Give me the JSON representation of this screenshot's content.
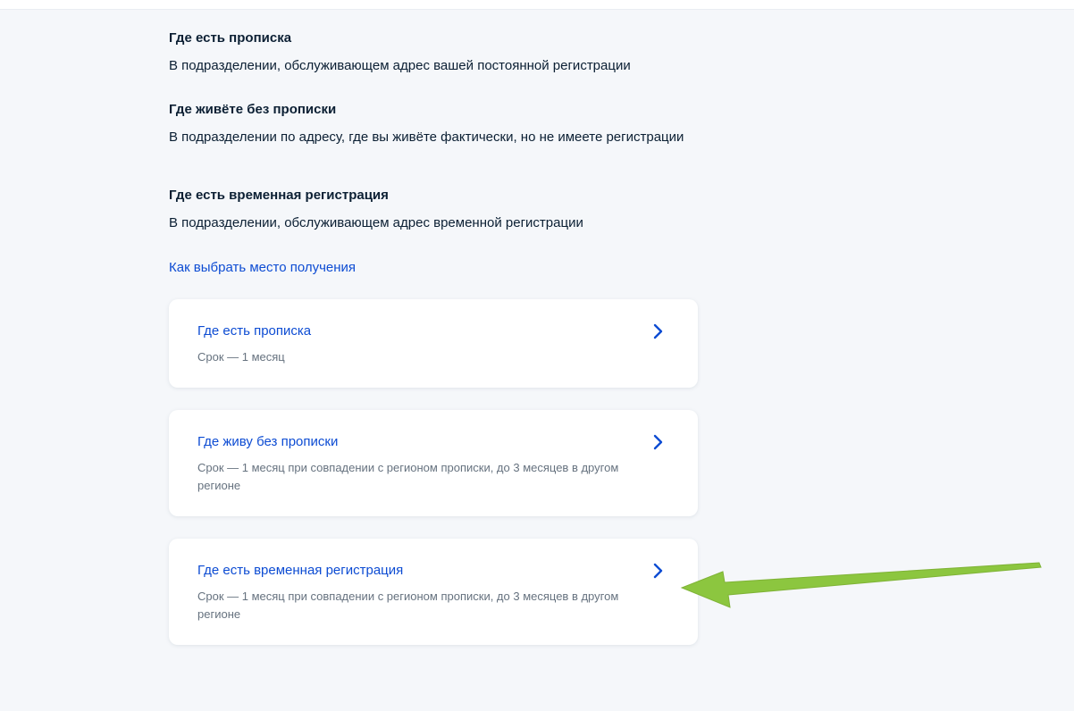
{
  "sections": [
    {
      "title": "Где есть прописка",
      "text": "В подразделении, обслуживающем адрес вашей постоянной регистрации"
    },
    {
      "title": "Где живёте без прописки",
      "text": "В подразделении по адресу, где вы живёте фактически, но не имеете регистрации"
    },
    {
      "title": "Где есть временная регистрация",
      "text": "В подразделении, обслуживающем адрес временной регистрации"
    }
  ],
  "link": {
    "label": "Как выбрать место получения"
  },
  "options": [
    {
      "title": "Где есть прописка",
      "subtitle": "Срок — 1 месяц"
    },
    {
      "title": "Где живу без прописки",
      "subtitle": "Срок — 1 месяц при совпадении с регионом прописки, до 3 месяцев в другом регионе"
    },
    {
      "title": "Где есть временная регистрация",
      "subtitle": "Срок — 1 месяц при совпадении с регионом прописки, до 3 месяцев в другом регионе"
    }
  ],
  "icons": {
    "chevron": "chevron-right-icon",
    "annotation": "green-arrow-icon"
  },
  "colors": {
    "link": "#0d4cd3",
    "text": "#0b1f33",
    "muted": "#66727f",
    "background": "#f5f7fa",
    "annotation_arrow": "#8cc63f"
  }
}
